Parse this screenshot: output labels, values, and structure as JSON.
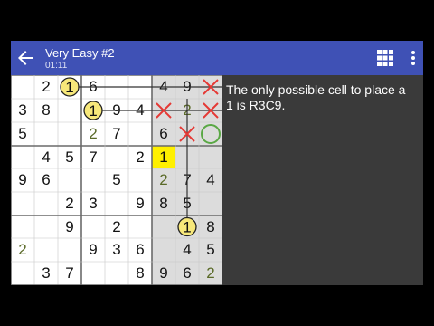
{
  "toolbar": {
    "title": "Very Easy #2",
    "timer": "01:11",
    "color": "#3f51b5"
  },
  "icons": {
    "back": "arrow-left-icon",
    "grid": "grid-apps-icon",
    "more": "more-vert-icon",
    "prev": "triangle-left-icon",
    "next": "triangle-right-icon",
    "close": "close-x-icon"
  },
  "hint": {
    "text": "The only possible cell to place a 1 is R3C9."
  },
  "colors": {
    "highlight": "#fff000",
    "circle_fill": "#f7e87a",
    "cross": "#e53935",
    "target_ring": "#5aa845",
    "nav_icons": "#5aa845",
    "panel": "#3a3a3a"
  },
  "board": {
    "rows": [
      [
        "",
        "2",
        "1",
        "6",
        "",
        "",
        "4",
        "9",
        ""
      ],
      [
        "3",
        "8",
        "",
        "1",
        "9",
        "4",
        "",
        "2",
        ""
      ],
      [
        "5",
        "",
        "",
        "2",
        "7",
        "",
        "6",
        "",
        ""
      ],
      [
        "",
        "4",
        "5",
        "7",
        "",
        "2",
        "1",
        "",
        ""
      ],
      [
        "9",
        "6",
        "",
        "",
        "5",
        "",
        "2",
        "7",
        "4"
      ],
      [
        "",
        "",
        "2",
        "3",
        "",
        "9",
        "8",
        "5",
        ""
      ],
      [
        "",
        "",
        "9",
        "",
        "2",
        "",
        "",
        "1",
        "8"
      ],
      [
        "2",
        "",
        "",
        "9",
        "3",
        "6",
        "",
        "4",
        "5"
      ],
      [
        "",
        "3",
        "7",
        "",
        "",
        "8",
        "9",
        "6",
        "2"
      ]
    ],
    "candidate_cells": [
      [
        2,
        3
      ],
      [
        4,
        6
      ],
      [
        1,
        7
      ],
      [
        7,
        0
      ],
      [
        8,
        8
      ]
    ],
    "circled_ones": [
      [
        0,
        2
      ],
      [
        1,
        3
      ],
      [
        6,
        7
      ]
    ],
    "crossed_cells": [
      [
        0,
        8
      ],
      [
        1,
        6
      ],
      [
        1,
        8
      ],
      [
        2,
        7
      ]
    ],
    "target_cell": [
      2,
      8
    ],
    "highlight_cell": [
      3,
      6
    ],
    "shaded_cells": [
      [
        0,
        6
      ],
      [
        0,
        7
      ],
      [
        0,
        8
      ],
      [
        1,
        6
      ],
      [
        1,
        7
      ],
      [
        1,
        8
      ],
      [
        2,
        6
      ],
      [
        2,
        7
      ],
      [
        2,
        8
      ],
      [
        3,
        6
      ],
      [
        3,
        7
      ],
      [
        3,
        8
      ],
      [
        4,
        6
      ],
      [
        4,
        7
      ],
      [
        4,
        8
      ],
      [
        5,
        6
      ],
      [
        5,
        7
      ],
      [
        5,
        8
      ],
      [
        6,
        6
      ],
      [
        6,
        7
      ],
      [
        6,
        8
      ],
      [
        7,
        6
      ],
      [
        7,
        7
      ],
      [
        7,
        8
      ],
      [
        8,
        6
      ],
      [
        8,
        7
      ],
      [
        8,
        8
      ]
    ]
  }
}
